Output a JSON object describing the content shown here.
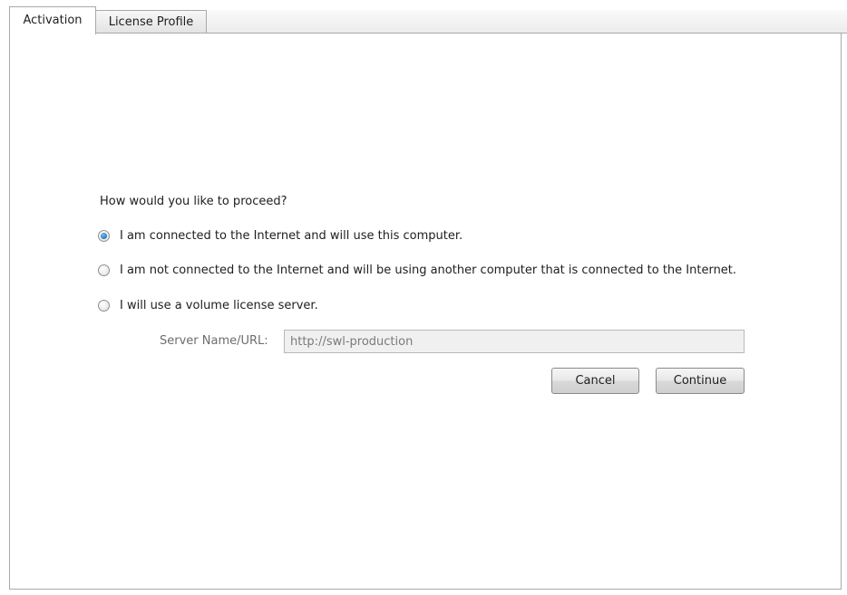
{
  "tabs": [
    {
      "label": "Activation",
      "active": true
    },
    {
      "label": "License Profile",
      "active": false
    }
  ],
  "activation": {
    "question": "How would you like to proceed?",
    "options": [
      {
        "label": "I am connected to the Internet and will use this computer.",
        "selected": true
      },
      {
        "label": "I am not connected to the Internet and will be using another computer that is connected to the Internet.",
        "selected": false
      },
      {
        "label": "I will use a volume license server.",
        "selected": false
      }
    ],
    "server_label": "Server Name/URL:",
    "server_value": "http://swl-production",
    "cancel_label": "Cancel",
    "continue_label": "Continue"
  },
  "colors": {
    "radio_selected": "#2a7fc4",
    "border": "#a9a9a9",
    "disabled_text": "#7a7a7a"
  }
}
